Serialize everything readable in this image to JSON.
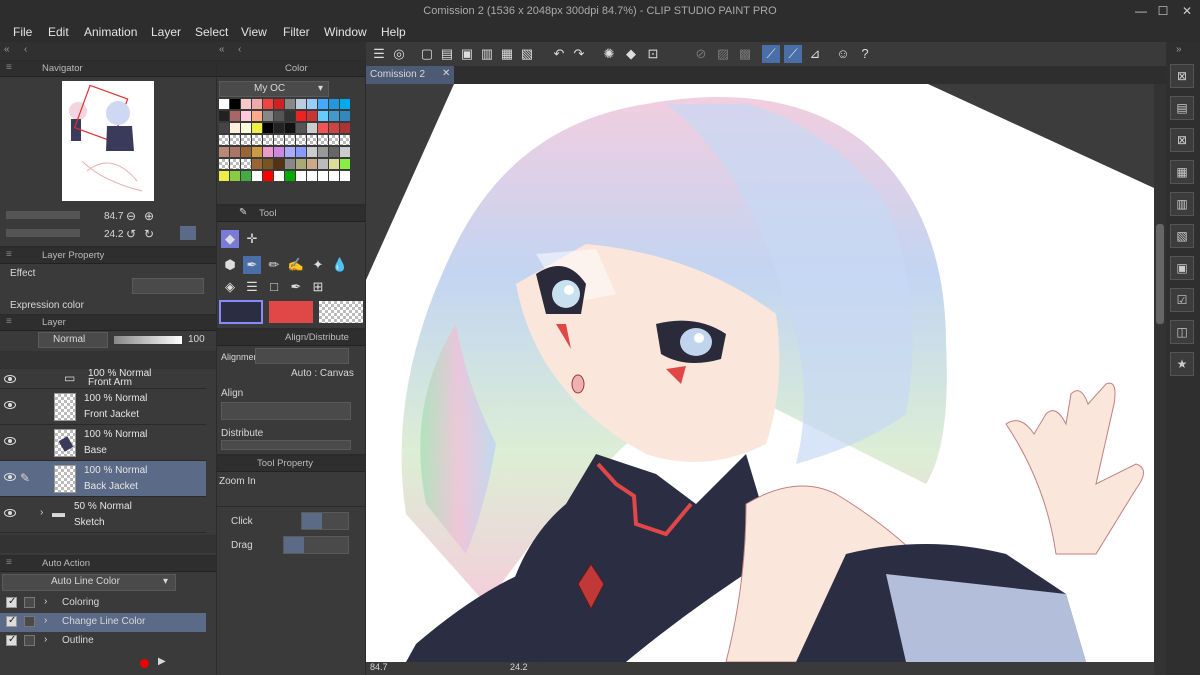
{
  "window": {
    "title": "Comission 2 (1536 x 2048px 300dpi 84.7%)  - CLIP STUDIO PAINT PRO",
    "minimize": "—",
    "maximize": "☐",
    "close": "✕"
  },
  "menu": [
    "File",
    "Edit",
    "Animation",
    "Layer",
    "Select",
    "View",
    "Filter",
    "Window",
    "Help"
  ],
  "navigator": {
    "tab": "Navigator",
    "zoom": "84.7",
    "rotation": "24.2"
  },
  "color_panel": {
    "tab": "Color",
    "set_name": "My OC"
  },
  "tool_panel": {
    "tab": "Tool"
  },
  "layer_property": {
    "tab": "Layer Property",
    "effect_label": "Effect",
    "expression_label": "Expression color"
  },
  "layer_panel": {
    "tab": "Layer",
    "blend_mode": "Normal",
    "opacity": "100",
    "layers": [
      {
        "opacity": "100 % Normal",
        "name": "Front Arm",
        "type": "folder"
      },
      {
        "opacity": "100 % Normal",
        "name": "Front Jacket",
        "type": "raster"
      },
      {
        "opacity": "100 % Normal",
        "name": "Base",
        "type": "raster"
      },
      {
        "opacity": "100 % Normal",
        "name": "Back Jacket",
        "type": "raster",
        "selected": true
      },
      {
        "opacity": "50 % Normal",
        "name": "Sketch",
        "type": "folder"
      }
    ]
  },
  "align_panel": {
    "tab": "Align/Distribute",
    "alignment_label": "Alignment",
    "auto_canvas": "Auto : Canvas",
    "align_label": "Align",
    "distribute_label": "Distribute"
  },
  "tool_property": {
    "tab": "Tool Property",
    "tool_name": "Zoom In",
    "click_label": "Click",
    "drag_label": "Drag"
  },
  "auto_action": {
    "tab": "Auto Action",
    "set_name": "Auto Line Color",
    "items": [
      {
        "label": "Coloring",
        "selected": false
      },
      {
        "label": "Change Line Color",
        "selected": true
      },
      {
        "label": "Outline",
        "selected": false
      }
    ]
  },
  "canvas": {
    "tab": "Comission 2",
    "zoom": "84.7",
    "rotation": "24.2"
  },
  "colors": {
    "main_color": "#2b2d42",
    "sub_color": "#e04848",
    "selection": "#5b6a86",
    "panel": "#3a3a3a"
  }
}
